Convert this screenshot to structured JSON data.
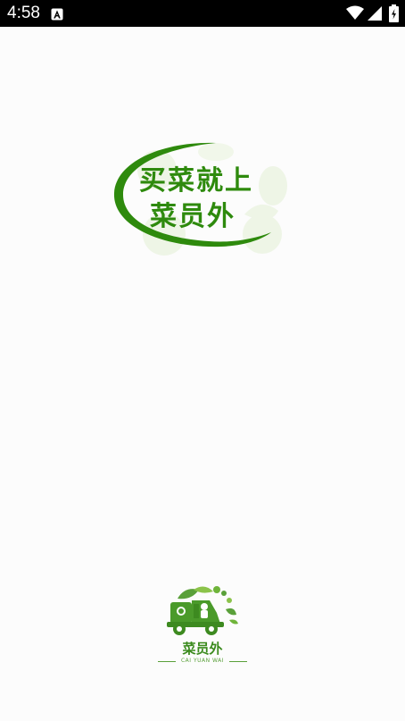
{
  "status_bar": {
    "time": "4:58",
    "icons": [
      "notification-app-icon",
      "wifi-icon",
      "signal-icon",
      "battery-charging-icon"
    ]
  },
  "splash": {
    "slogan_line1": "买菜就上",
    "slogan_line2": "菜员外",
    "brand_name": "菜员外",
    "brand_subtitle": "CAI YUAN WAI"
  },
  "colors": {
    "status_bar_bg": "#000000",
    "page_bg": "#fcfcfc",
    "brand_green": "#2e8a0d",
    "light_green": "#e8f3dc"
  }
}
